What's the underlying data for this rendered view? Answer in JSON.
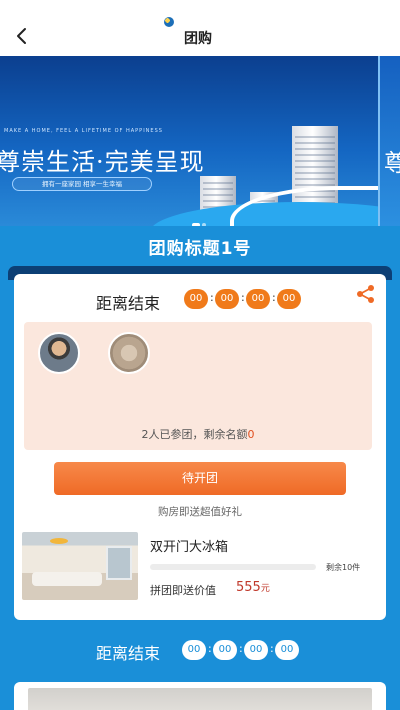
{
  "header": {
    "title": "团购",
    "back_icon": "chevron-left-icon",
    "logo_icon": "app-logo-icon"
  },
  "banner": {
    "tagline": "MAKE A HOME, FEEL A LIFETIME OF HAPPINESS",
    "headline": "尊崇生活·完美呈现",
    "badge": "拥有一座家园 相享一生幸福",
    "next_slide_headline": "尊"
  },
  "group": {
    "title": "团购标题1号"
  },
  "card": {
    "countdown_label": "距离结束",
    "countdown": [
      "00",
      "00",
      "00",
      "00"
    ],
    "share_icon": "share-icon",
    "members_status_prefix": "2人已参团，剩余名额",
    "members_remaining": "0",
    "join_button": "待开团",
    "join_hint": "购房即送超值好礼",
    "product": {
      "name": "双开门大冰箱",
      "stock_text": "剩余10件",
      "gift_label": "拼团即送价值",
      "gift_price": "555",
      "gift_unit": "元"
    }
  },
  "countdown2": {
    "label": "距离结束",
    "values": [
      "00",
      "00",
      "00",
      "00"
    ]
  },
  "colors": {
    "accent": "#f07a1a",
    "background": "#1a8fd8",
    "price": "#c0392b"
  }
}
